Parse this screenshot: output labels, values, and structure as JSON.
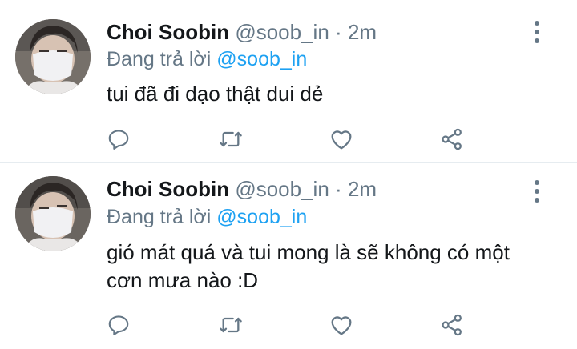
{
  "tweets": [
    {
      "name": "Choi Soobin",
      "handle": "@soob_in",
      "separator": "·",
      "time": "2m",
      "reply_prefix": "Đang trả lời",
      "reply_mention": "@soob_in",
      "text": "tui đã đi dạo thật dui dẻ"
    },
    {
      "name": "Choi Soobin",
      "handle": "@soob_in",
      "separator": "·",
      "time": "2m",
      "reply_prefix": "Đang trả lời",
      "reply_mention": "@soob_in",
      "text": "gió mát quá và tui mong là sẽ không có một cơn mưa nào :D"
    }
  ],
  "icons": {
    "reply": "reply-icon",
    "retweet": "retweet-icon",
    "like": "heart-icon",
    "share": "share-icon",
    "more": "more-vertical-icon"
  },
  "colors": {
    "text": "#14171a",
    "muted": "#657786",
    "link": "#1da1f2",
    "divider": "#e6ecf0"
  }
}
